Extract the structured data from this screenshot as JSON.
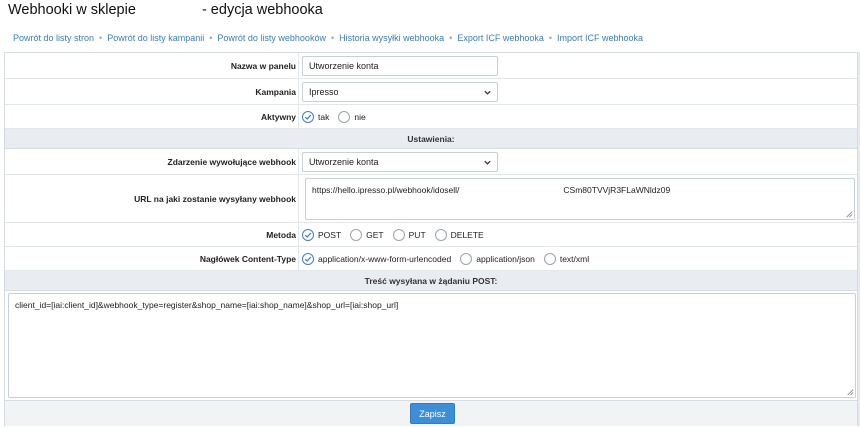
{
  "page": {
    "title_prefix": "Webhooki w sklepie",
    "title_suffix": "- edycja webhooka"
  },
  "breadcrumbs": [
    "Powrót do listy stron",
    "Powrót do listy kampanii",
    "Powrót do listy webhooków",
    "Historia wysyłki webhooka",
    "Export ICF webhooka",
    "Import ICF webhooka"
  ],
  "form": {
    "panel_name": {
      "label": "Nazwa w panelu",
      "value": "Utworzenie konta"
    },
    "campaign": {
      "label": "Kampania",
      "value": "Ipresso"
    },
    "active": {
      "label": "Aktywny",
      "options": [
        "tak",
        "nie"
      ],
      "selected": "tak"
    },
    "settings_header": "Ustawienia:",
    "trigger_event": {
      "label": "Zdarzenie wywołujące webhook",
      "value": "Utworzenie konta"
    },
    "url": {
      "label": "URL na jaki zostanie wysyłany webhook",
      "value_start": "https://hello.ipresso.pl/webhook/idosell/",
      "value_end": "CSm80TVVjR3FLaWNldz09"
    },
    "method": {
      "label": "Metoda",
      "options": [
        "POST",
        "GET",
        "PUT",
        "DELETE"
      ],
      "selected": "POST"
    },
    "content_type": {
      "label": "Nagłówek Content-Type",
      "options": [
        "application/x-www-form-urlencoded",
        "application/json",
        "text/xml"
      ],
      "selected": "application/x-www-form-urlencoded"
    },
    "body_header": "Treść wysyłana w żądaniu POST:",
    "body_value": "client_id=[iai:client_id]&webhook_type=register&shop_name=[iai:shop_name]&shop_url=[iai:shop_url]",
    "submit_label": "Zapisz"
  },
  "colors": {
    "link": "#3b7cb8",
    "accent": "#3c8fd6",
    "section_bg": "#e9edf1"
  }
}
